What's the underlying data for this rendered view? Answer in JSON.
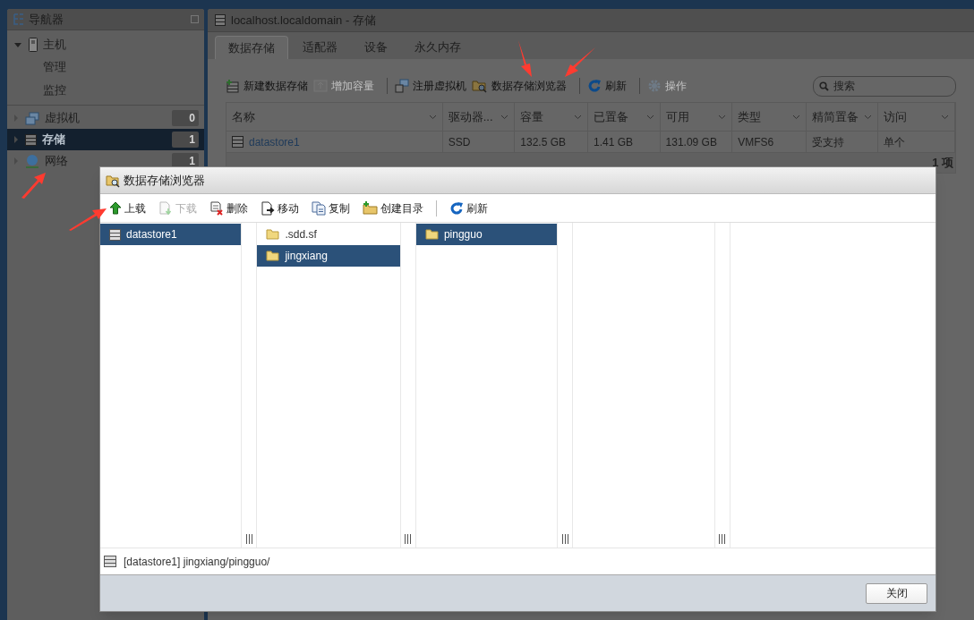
{
  "navigator": {
    "title": "导航器",
    "items": [
      {
        "label": "主机",
        "kind": "parent",
        "expanded": true,
        "selected": false,
        "children": [
          {
            "label": "管理",
            "selected": false
          },
          {
            "label": "监控",
            "selected": false
          }
        ]
      },
      {
        "label": "虚拟机",
        "kind": "counted",
        "count": "0",
        "selected": false
      },
      {
        "label": "存储",
        "kind": "counted",
        "count": "1",
        "selected": true
      },
      {
        "label": "网络",
        "kind": "counted",
        "count": "1",
        "selected": false
      }
    ]
  },
  "main": {
    "title": "localhost.localdomain - 存储",
    "tabs": [
      {
        "label": "数据存储",
        "selected": true
      },
      {
        "label": "适配器",
        "selected": false
      },
      {
        "label": "设备",
        "selected": false
      },
      {
        "label": "永久内存",
        "selected": false
      }
    ],
    "toolbar": [
      {
        "label": "新建数据存储",
        "disabled": false
      },
      {
        "label": "增加容量",
        "disabled": true
      },
      {
        "kind": "sep"
      },
      {
        "label": "注册虚拟机",
        "disabled": false
      },
      {
        "label": "数据存储浏览器",
        "disabled": false
      },
      {
        "kind": "sep"
      },
      {
        "label": "刷新",
        "disabled": false
      },
      {
        "kind": "sep"
      },
      {
        "label": "操作",
        "disabled": true
      }
    ],
    "search": {
      "placeholder": "搜索"
    },
    "table": {
      "columns": [
        "名称",
        "驱动器...",
        "容量",
        "已置备",
        "可用",
        "类型",
        "精简置备",
        "访问"
      ],
      "rows": [
        [
          "datastore1",
          "SSD",
          "132.5 GB",
          "1.41 GB",
          "131.09 GB",
          "VMFS6",
          "受支持",
          "单个"
        ]
      ]
    },
    "count": "1 项"
  },
  "dialog": {
    "title": "数据存储浏览器",
    "toolbar": [
      {
        "label": "上载",
        "disabled": false
      },
      {
        "label": "下载",
        "disabled": true
      },
      {
        "label": "删除",
        "disabled": false
      },
      {
        "label": "移动",
        "disabled": false
      },
      {
        "label": "复制",
        "disabled": false
      },
      {
        "label": "创建目录",
        "disabled": false
      },
      {
        "kind": "sep"
      },
      {
        "label": "刷新",
        "disabled": false
      }
    ],
    "columns": [
      [
        {
          "label": "datastore1",
          "kind": "datastore",
          "selected": true
        }
      ],
      [
        {
          "label": ".sdd.sf",
          "kind": "folder",
          "selected": false
        },
        {
          "label": "jingxiang",
          "kind": "folder",
          "selected": true
        }
      ],
      [
        {
          "label": "pingguo",
          "kind": "folder",
          "selected": true
        }
      ],
      [],
      []
    ],
    "path": "[datastore1] jingxiang/pingguo/",
    "close_button": "关闭"
  }
}
